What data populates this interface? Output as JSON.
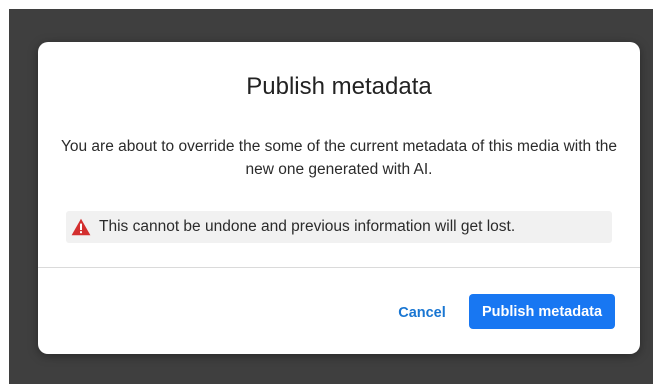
{
  "dialog": {
    "title": "Publish metadata",
    "message": "You are about to override the some of the current metadata of this media with the new one generated with AI.",
    "warning": {
      "icon": "warning-triangle-icon",
      "icon_color": "#d32f2f",
      "text": "This cannot be undone and previous information will get lost."
    },
    "actions": {
      "cancel_label": "Cancel",
      "publish_label": "Publish metadata"
    }
  },
  "colors": {
    "overlay": "#3f3f3f",
    "accent": "#1877f2",
    "link": "#1976d2"
  }
}
